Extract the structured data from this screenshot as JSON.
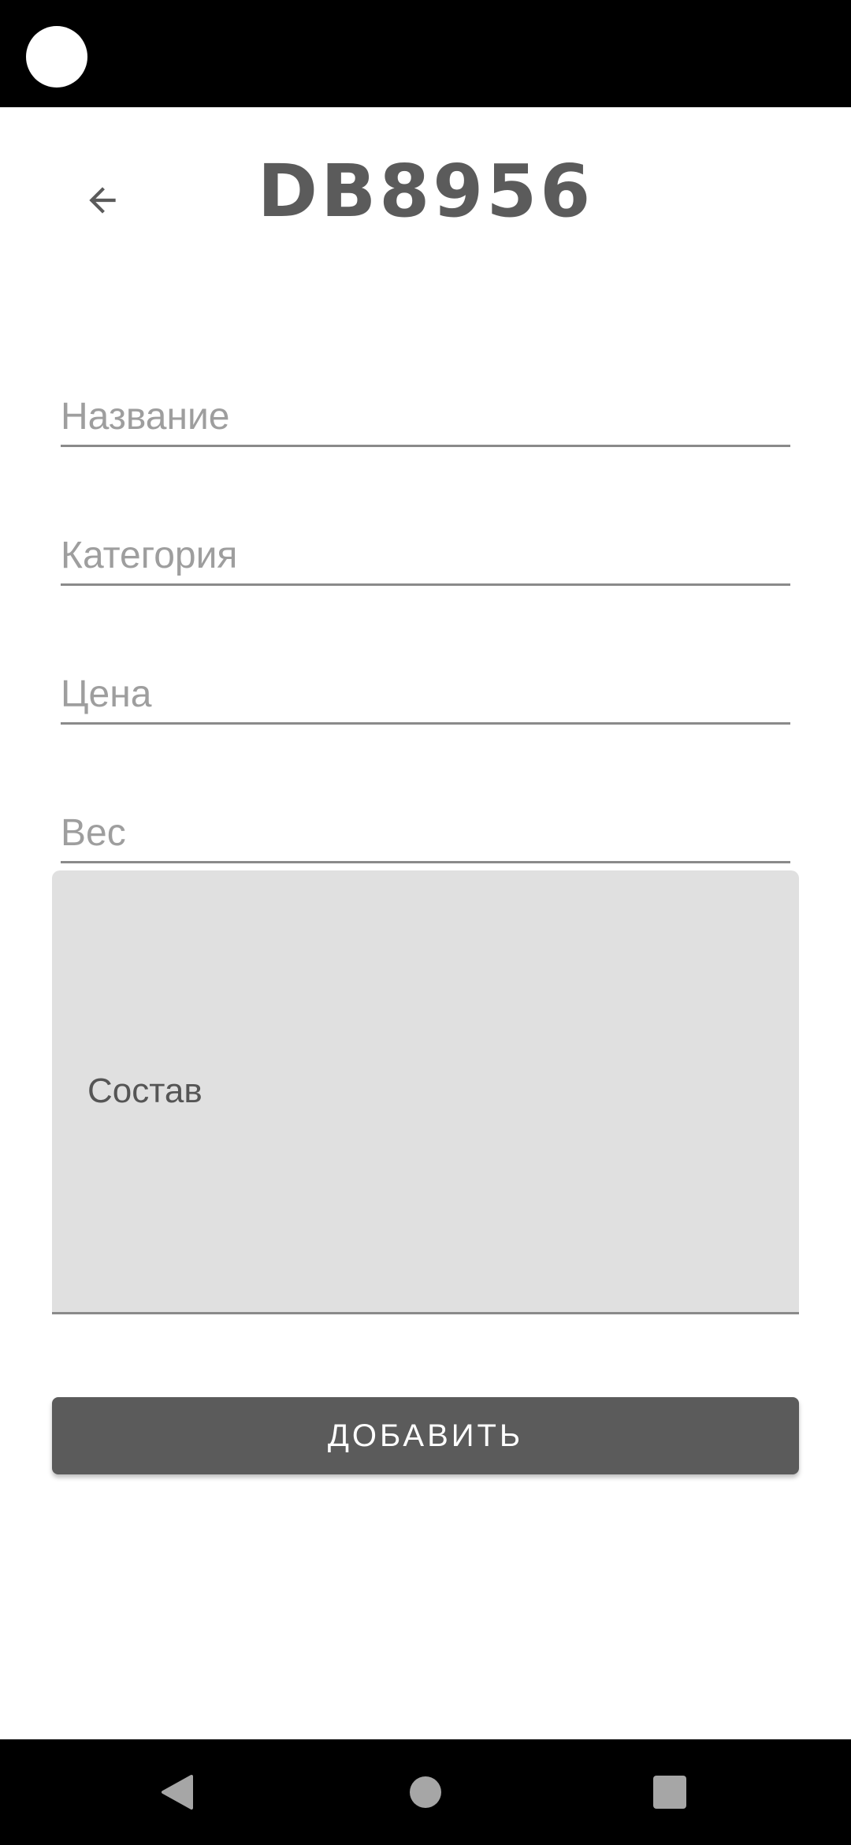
{
  "header": {
    "title": "DB8956"
  },
  "form": {
    "name_placeholder": "Название",
    "category_placeholder": "Категория",
    "price_placeholder": "Цена",
    "weight_placeholder": "Вес",
    "composition_label": "Состав",
    "submit_label": "ДОБАВИТЬ"
  },
  "icons": {
    "back": "arrow-left-icon",
    "nav_back": "triangle-back-icon",
    "nav_home": "circle-home-icon",
    "nav_recents": "square-recents-icon"
  },
  "colors": {
    "primary": "#5b5b5b",
    "field_underline": "#8a8a8a",
    "placeholder": "#9e9e9e",
    "composition_bg": "#e0e0e0",
    "system_bar": "#000000",
    "nav_icon": "#a6a6a6"
  }
}
